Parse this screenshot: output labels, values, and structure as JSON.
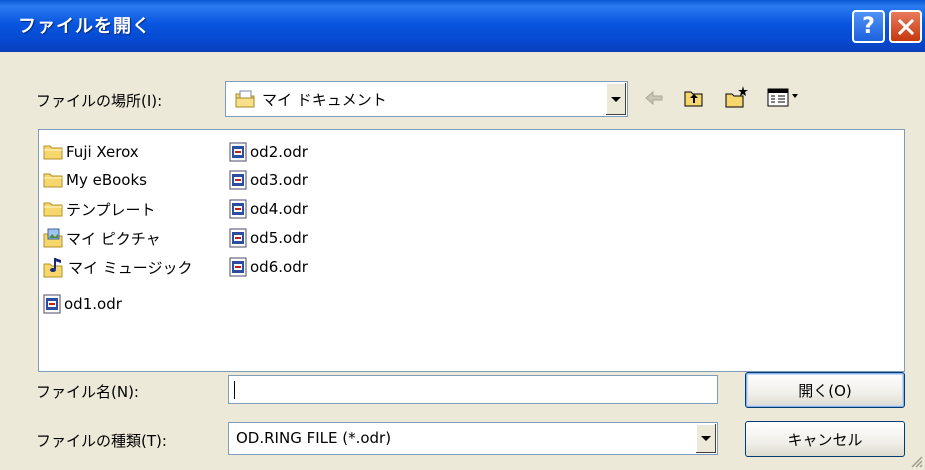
{
  "window": {
    "title": "ファイルを開く",
    "help": "?",
    "close": "✕"
  },
  "look_in": {
    "label": "ファイルの場所(I):",
    "value": "マイ ドキュメント"
  },
  "toolbar": {
    "back_icon": "back-arrow-icon",
    "up_icon": "up-folder-icon",
    "new_folder_icon": "new-folder-icon",
    "views_icon": "views-menu-icon"
  },
  "files": [
    {
      "name": "Fuji Xerox",
      "icon": "folder-icon"
    },
    {
      "name": "My eBooks",
      "icon": "folder-icon"
    },
    {
      "name": "テンプレート",
      "icon": "folder-icon"
    },
    {
      "name": "マイ ピクチャ",
      "icon": "my-pictures-icon"
    },
    {
      "name": "マイ ミュージック",
      "icon": "my-music-icon"
    },
    {
      "name": "od1.odr",
      "icon": "odr-file-icon"
    },
    {
      "name": "od2.odr",
      "icon": "odr-file-icon"
    },
    {
      "name": "od3.odr",
      "icon": "odr-file-icon"
    },
    {
      "name": "od4.odr",
      "icon": "odr-file-icon"
    },
    {
      "name": "od5.odr",
      "icon": "odr-file-icon"
    },
    {
      "name": "od6.odr",
      "icon": "odr-file-icon"
    }
  ],
  "filename": {
    "label": "ファイル名(N):",
    "value": ""
  },
  "filetype": {
    "label": "ファイルの種類(T):",
    "value": "OD.RING FILE (*.odr)"
  },
  "buttons": {
    "open": "開く(O)",
    "cancel": "キャンセル"
  },
  "colors": {
    "titlebar": "#0a58d6",
    "dialog_bg": "#ece9d8",
    "field_border": "#7f9db9"
  }
}
